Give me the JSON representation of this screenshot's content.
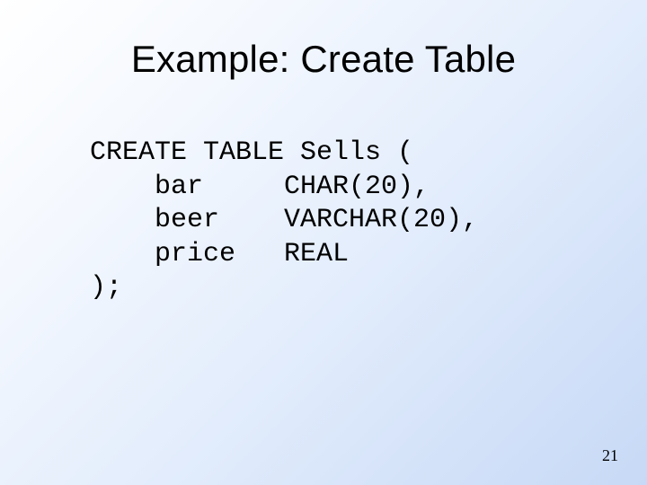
{
  "title": "Example: Create Table",
  "code": "CREATE TABLE Sells (\n    bar     CHAR(20),\n    beer    VARCHAR(20),\n    price   REAL\n);",
  "page_number": "21"
}
